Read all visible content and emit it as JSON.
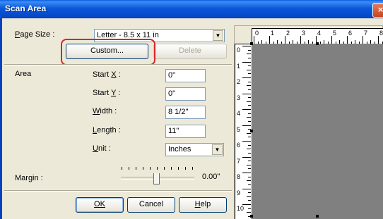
{
  "window": {
    "title": "Scan Area",
    "close_glyph": "×"
  },
  "page_size": {
    "label": "Page Size :",
    "value": "Letter - 8.5 x 11 in"
  },
  "buttons": {
    "custom": "Custom...",
    "delete": "Delete",
    "ok": "OK",
    "cancel": "Cancel",
    "help": "Help"
  },
  "area": {
    "label": "Area",
    "fields": [
      {
        "label": "Start X :",
        "value": "0\""
      },
      {
        "label": "Start Y :",
        "value": "0\""
      },
      {
        "label": "Width :",
        "value": "8 1/2\""
      },
      {
        "label": "Length :",
        "value": "11\""
      }
    ],
    "unit": {
      "label": "Unit :",
      "value": "Inches"
    }
  },
  "margin": {
    "label": "Margin :",
    "value": "0.00\""
  },
  "ruler": {
    "horizontal": [
      "0",
      "1",
      "2",
      "3",
      "4",
      "5",
      "6",
      "7",
      "8"
    ],
    "vertical": [
      "0",
      "1",
      "2",
      "3",
      "4",
      "5",
      "6",
      "7",
      "8",
      "9",
      "10"
    ]
  },
  "colors": {
    "titlebar": "#0a58d8",
    "highlight": "#d8262a",
    "scan_area": "#808080",
    "dialog": "#ece9d8"
  },
  "icons": [
    "close-icon",
    "dropdown-arrow-icon"
  ]
}
